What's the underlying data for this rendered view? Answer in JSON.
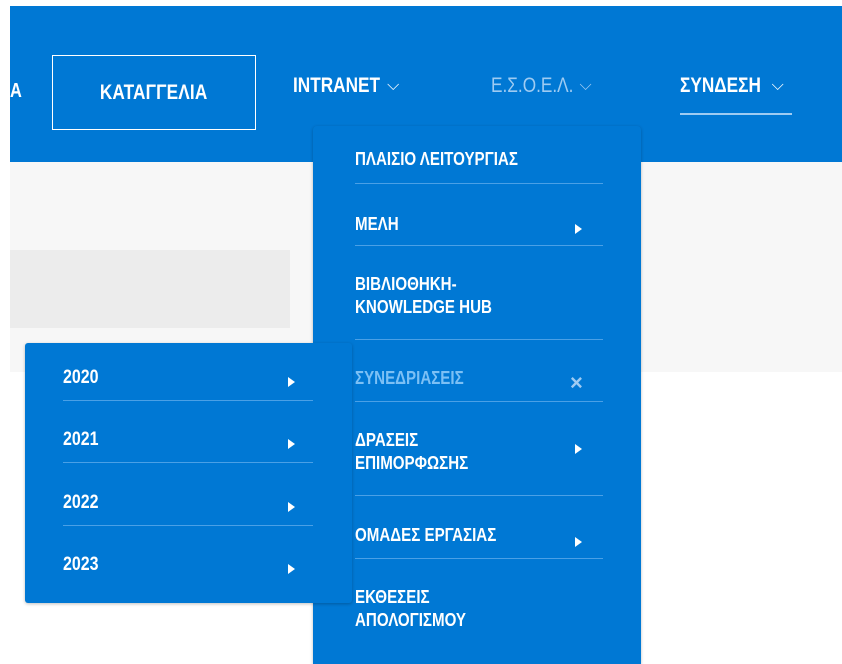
{
  "nav": {
    "cut_letter": "Α",
    "report_label": "ΚΑΤΑΓΓΕΛΙΑ",
    "intranet_label": "INTRANET",
    "esoel_label": "Ε.Σ.Ο.Ε.Λ.",
    "login_label": "ΣΥΝΔΕΣΗ",
    "chevron": "⌵"
  },
  "main_menu": {
    "items": [
      {
        "label": "ΠΛΑΙΣΙΟ ΛΕΙΤΟΥΡΓΙΑΣ"
      },
      {
        "label": "ΜΕΛΗ"
      },
      {
        "label_line1": "ΒΙΒΛΙΟΘΗΚΗ-",
        "label_line2": "KNOWLEDGE HUB"
      },
      {
        "label": "ΣΥΝΕΔΡΙΑΣΕΙΣ",
        "close": "×"
      },
      {
        "label_line1": "ΔΡΑΣΕΙΣ",
        "label_line2": "ΕΠΙΜΟΡΦΩΣΗΣ"
      },
      {
        "label": "ΟΜΑΔΕΣ ΕΡΓΑΣΙΑΣ"
      },
      {
        "label_line1": "ΕΚΘΕΣΕΙΣ",
        "label_line2": "ΑΠΟΛΟΓΙΣΜΟΥ"
      }
    ]
  },
  "sub_menu": {
    "items": [
      {
        "label": "2020"
      },
      {
        "label": "2021"
      },
      {
        "label": "2022"
      },
      {
        "label": "2023"
      }
    ]
  },
  "colors": {
    "brand_blue": "#0078d4",
    "dim_text": "#9ecbf2",
    "separator": "#4aa0e6"
  }
}
